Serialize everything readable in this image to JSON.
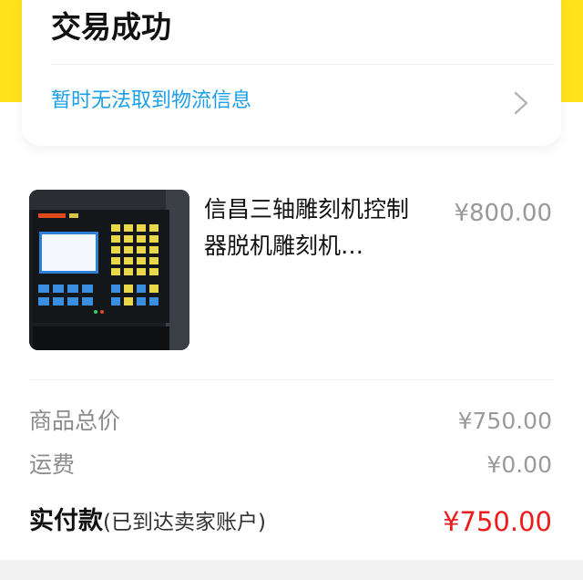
{
  "order_status": {
    "title": "交易成功",
    "logistics_text": "暂时无法取到物流信息"
  },
  "item": {
    "title": "信昌三轴雕刻机控制器脱机雕刻机…",
    "price": "¥800.00",
    "image_label": "信昌三轴雕刻机控制器 product photo"
  },
  "summary": {
    "goods_total_label": "商品总价",
    "goods_total_value": "¥750.00",
    "shipping_label": "运费",
    "shipping_value": "¥0.00",
    "paid_label": "实付款",
    "paid_note": "(已到达卖家账户)",
    "paid_value": "¥750.00"
  },
  "colors": {
    "brand_yellow": "#ffe21a",
    "link_blue": "#1a9ee8",
    "price_red": "#ee1c1c"
  }
}
